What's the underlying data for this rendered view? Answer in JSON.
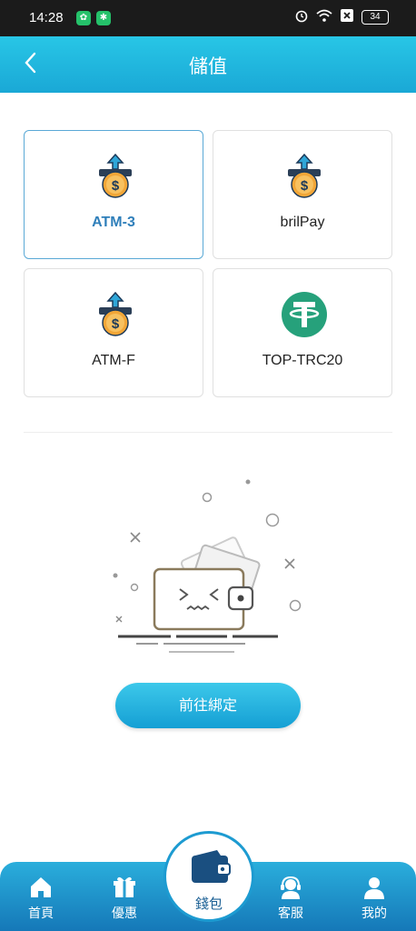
{
  "status_bar": {
    "time": "14:28",
    "battery": "34"
  },
  "header": {
    "title": "儲值"
  },
  "methods": [
    {
      "label": "ATM-3",
      "icon": "atm-coin-icon",
      "selected": true
    },
    {
      "label": "brilPay",
      "icon": "atm-coin-icon",
      "selected": false
    },
    {
      "label": "ATM-F",
      "icon": "atm-coin-icon",
      "selected": false
    },
    {
      "label": "TOP-TRC20",
      "icon": "tether-icon",
      "selected": false
    }
  ],
  "bind_button": {
    "label": "前往綁定"
  },
  "bottom_nav": {
    "items": [
      {
        "label": "首頁",
        "icon": "home-icon"
      },
      {
        "label": "優惠",
        "icon": "gift-icon"
      },
      {
        "label": "錢包",
        "icon": "wallet-icon"
      },
      {
        "label": "客服",
        "icon": "support-icon"
      },
      {
        "label": "我的",
        "icon": "user-icon"
      }
    ]
  },
  "colors": {
    "accent": "#1aa8d6",
    "selected_text": "#2f7fba",
    "tether_green": "#26a17b"
  }
}
